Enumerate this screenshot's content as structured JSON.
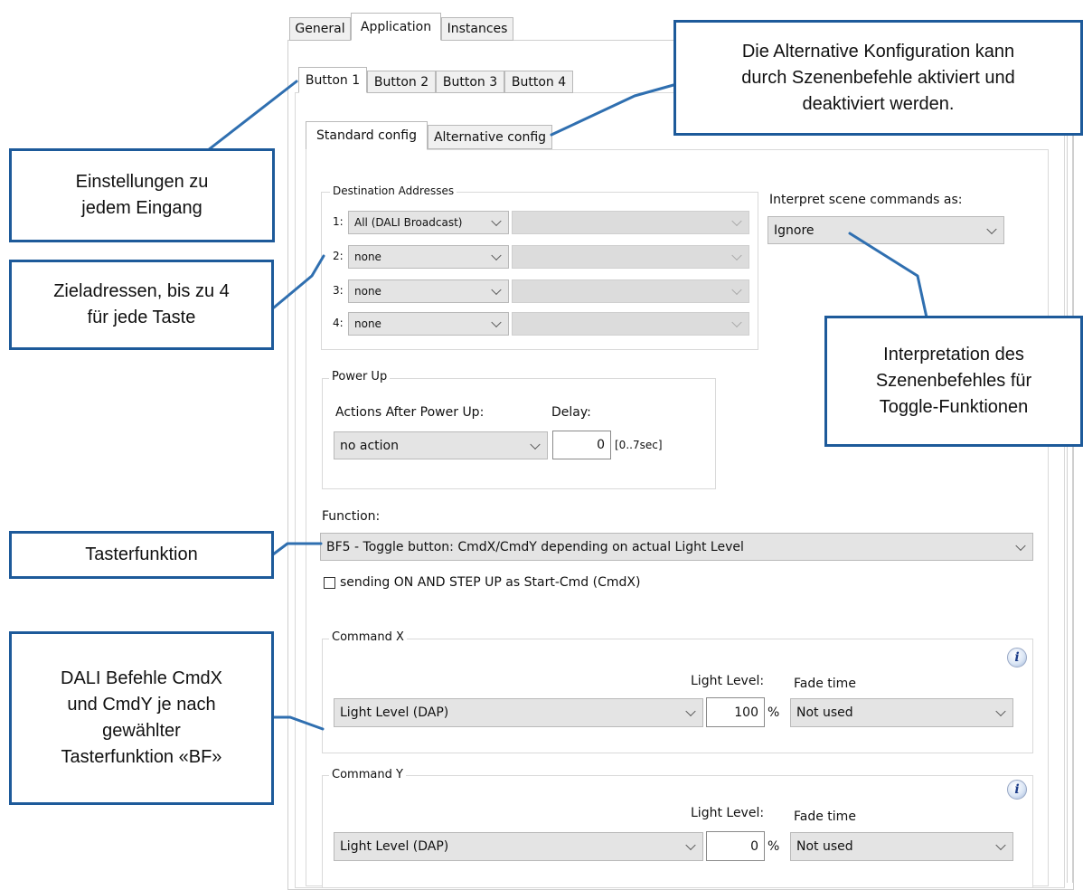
{
  "top_tabs": [
    "General",
    "Application",
    "Instances"
  ],
  "button_tabs": [
    "Button 1",
    "Button 2",
    "Button 3",
    "Button 4"
  ],
  "config_tabs": [
    "Standard config",
    "Alternative config"
  ],
  "destination": {
    "title": "Destination Addresses",
    "rows": [
      {
        "num": "1:",
        "value": "All (DALI Broadcast)"
      },
      {
        "num": "2:",
        "value": "none"
      },
      {
        "num": "3:",
        "value": "none"
      },
      {
        "num": "4:",
        "value": "none"
      }
    ]
  },
  "scene": {
    "label": "Interpret scene commands as:",
    "value": "Ignore"
  },
  "power_up": {
    "title": "Power Up",
    "actions_label": "Actions After Power Up:",
    "delay_label": "Delay:",
    "action_value": "no action",
    "delay_value": "0",
    "delay_unit": "[0..7sec]"
  },
  "function": {
    "label": "Function:",
    "value": "BF5 - Toggle button:  CmdX/CmdY depending on actual Light Level",
    "checkbox_label": "sending ON AND STEP UP as Start-Cmd (CmdX)",
    "checkbox_checked": false
  },
  "command_x": {
    "title": "Command X",
    "light_level_label": "Light Level:",
    "fade_label": "Fade time",
    "command_value": "Light Level (DAP)",
    "level_value": "100",
    "unit": "%",
    "fade_value": "Not used"
  },
  "command_y": {
    "title": "Command Y",
    "light_level_label": "Light Level:",
    "fade_label": "Fade time",
    "command_value": "Light Level (DAP)",
    "level_value": "0",
    "unit": "%",
    "fade_value": "Not used"
  },
  "callouts": {
    "einstellungen": "Einstellungen zu\njedem Eingang",
    "zieladressen": "Zieladressen, bis zu 4\nfür jede Taste",
    "tasterfunktion": "Tasterfunktion",
    "dali": "DALI Befehle CmdX\nund CmdY je nach\ngewählter\nTasterfunktion «BF»",
    "alternative": "Die Alternative Konfiguration kann\ndurch Szenenbefehle aktiviert und\ndeaktiviert werden.",
    "interpretation": "Interpretation des\nSzenenbefehles für\nToggle-Funktionen"
  },
  "icons": {
    "info": "i",
    "chevron": "chevron-down-icon"
  },
  "colors": {
    "callout_border": "#1d5a9a",
    "leader_line": "#2f6fb0"
  }
}
